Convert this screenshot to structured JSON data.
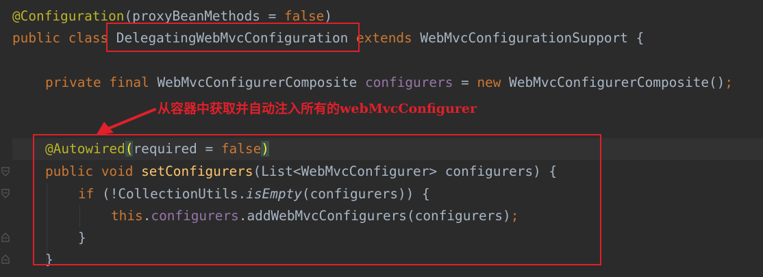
{
  "code": {
    "l1": {
      "ann": "@Configuration",
      "p1": "(",
      "id": "proxyBeanMethods",
      "eq": " = ",
      "kw": "false",
      "p2": ")"
    },
    "l2": {
      "kw1": "public class ",
      "cls": "DelegatingWebMvcConfiguration",
      "kw2": " extends ",
      "base": "WebMvcConfigurationSupport {"
    },
    "l4": {
      "kw1": "private final ",
      "type": "WebMvcConfigurerComposite ",
      "field": "configurers",
      "eq": " = ",
      "kw2": "new ",
      "ctor": "WebMvcConfigurerComposite()",
      "semi": ";"
    },
    "l6": {
      "ann": "@Autowired",
      "p1": "(",
      "id": "required",
      "eq": " = ",
      "kw": "false",
      "p2": ")"
    },
    "l7": {
      "kw1": "public void ",
      "method": "setConfigurers",
      "rest": "(List<WebMvcConfigurer> configurers) {"
    },
    "l8": {
      "kw": "if ",
      "p1": "(!CollectionUtils.",
      "method": "isEmpty",
      "p2": "(configurers)) {"
    },
    "l9": {
      "kw": "this",
      "dot": ".",
      "field": "configurers",
      "rest": ".addWebMvcConfigurers(configurers)",
      "semi": ";"
    },
    "l10": {
      "brace": "}"
    },
    "l11": {
      "brace": "}"
    }
  },
  "annotation": {
    "text": "从容器中获取并自动注入所有的webMvcConfigurer"
  },
  "colors": {
    "highlight_box": "#e0202b",
    "background": "#2b2b2b"
  }
}
